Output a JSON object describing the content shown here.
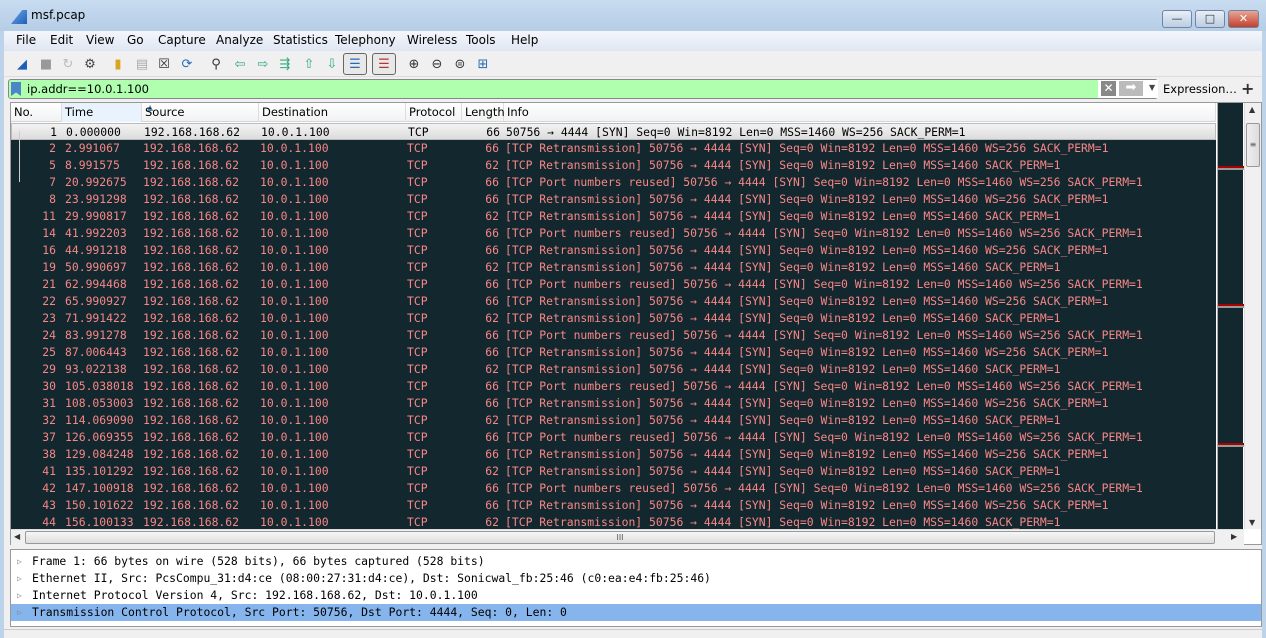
{
  "window": {
    "title": "msf.pcap"
  },
  "menu": [
    "File",
    "Edit",
    "View",
    "Go",
    "Capture",
    "Analyze",
    "Statistics",
    "Telephony",
    "Wireless",
    "Tools",
    "Help"
  ],
  "filter": {
    "value": "ip.addr==10.0.1.100",
    "expression_label": "Expression…",
    "add_label": "+"
  },
  "columns": [
    "No.",
    "Time",
    "Source",
    "Destination",
    "Protocol",
    "Length",
    "Info"
  ],
  "colors": {
    "row_bg": "#12272e",
    "row_fg": "#f78787",
    "selected_detail": "#86b5ee"
  },
  "packets": [
    {
      "no": "1",
      "time": "0.000000",
      "src": "192.168.168.62",
      "dst": "10.0.1.100",
      "proto": "TCP",
      "len": "66",
      "info": "50756 → 4444 [SYN] Seq=0 Win=8192 Len=0 MSS=1460 WS=256 SACK_PERM=1"
    },
    {
      "no": "2",
      "time": "2.991067",
      "src": "192.168.168.62",
      "dst": "10.0.1.100",
      "proto": "TCP",
      "len": "66",
      "info": "[TCP Retransmission] 50756 → 4444 [SYN] Seq=0 Win=8192 Len=0 MSS=1460 WS=256 SACK_PERM=1"
    },
    {
      "no": "5",
      "time": "8.991575",
      "src": "192.168.168.62",
      "dst": "10.0.1.100",
      "proto": "TCP",
      "len": "62",
      "info": "[TCP Retransmission] 50756 → 4444 [SYN] Seq=0 Win=8192 Len=0 MSS=1460 SACK_PERM=1"
    },
    {
      "no": "7",
      "time": "20.992675",
      "src": "192.168.168.62",
      "dst": "10.0.1.100",
      "proto": "TCP",
      "len": "66",
      "info": "[TCP Port numbers reused] 50756 → 4444 [SYN] Seq=0 Win=8192 Len=0 MSS=1460 WS=256 SACK_PERM=1"
    },
    {
      "no": "8",
      "time": "23.991298",
      "src": "192.168.168.62",
      "dst": "10.0.1.100",
      "proto": "TCP",
      "len": "66",
      "info": "[TCP Retransmission] 50756 → 4444 [SYN] Seq=0 Win=8192 Len=0 MSS=1460 WS=256 SACK_PERM=1"
    },
    {
      "no": "11",
      "time": "29.990817",
      "src": "192.168.168.62",
      "dst": "10.0.1.100",
      "proto": "TCP",
      "len": "62",
      "info": "[TCP Retransmission] 50756 → 4444 [SYN] Seq=0 Win=8192 Len=0 MSS=1460 SACK_PERM=1"
    },
    {
      "no": "14",
      "time": "41.992203",
      "src": "192.168.168.62",
      "dst": "10.0.1.100",
      "proto": "TCP",
      "len": "66",
      "info": "[TCP Port numbers reused] 50756 → 4444 [SYN] Seq=0 Win=8192 Len=0 MSS=1460 WS=256 SACK_PERM=1"
    },
    {
      "no": "16",
      "time": "44.991218",
      "src": "192.168.168.62",
      "dst": "10.0.1.100",
      "proto": "TCP",
      "len": "66",
      "info": "[TCP Retransmission] 50756 → 4444 [SYN] Seq=0 Win=8192 Len=0 MSS=1460 WS=256 SACK_PERM=1"
    },
    {
      "no": "19",
      "time": "50.990697",
      "src": "192.168.168.62",
      "dst": "10.0.1.100",
      "proto": "TCP",
      "len": "62",
      "info": "[TCP Retransmission] 50756 → 4444 [SYN] Seq=0 Win=8192 Len=0 MSS=1460 SACK_PERM=1"
    },
    {
      "no": "21",
      "time": "62.994468",
      "src": "192.168.168.62",
      "dst": "10.0.1.100",
      "proto": "TCP",
      "len": "66",
      "info": "[TCP Port numbers reused] 50756 → 4444 [SYN] Seq=0 Win=8192 Len=0 MSS=1460 WS=256 SACK_PERM=1"
    },
    {
      "no": "22",
      "time": "65.990927",
      "src": "192.168.168.62",
      "dst": "10.0.1.100",
      "proto": "TCP",
      "len": "66",
      "info": "[TCP Retransmission] 50756 → 4444 [SYN] Seq=0 Win=8192 Len=0 MSS=1460 WS=256 SACK_PERM=1"
    },
    {
      "no": "23",
      "time": "71.991422",
      "src": "192.168.168.62",
      "dst": "10.0.1.100",
      "proto": "TCP",
      "len": "62",
      "info": "[TCP Retransmission] 50756 → 4444 [SYN] Seq=0 Win=8192 Len=0 MSS=1460 SACK_PERM=1"
    },
    {
      "no": "24",
      "time": "83.991278",
      "src": "192.168.168.62",
      "dst": "10.0.1.100",
      "proto": "TCP",
      "len": "66",
      "info": "[TCP Port numbers reused] 50756 → 4444 [SYN] Seq=0 Win=8192 Len=0 MSS=1460 WS=256 SACK_PERM=1"
    },
    {
      "no": "25",
      "time": "87.006443",
      "src": "192.168.168.62",
      "dst": "10.0.1.100",
      "proto": "TCP",
      "len": "66",
      "info": "[TCP Retransmission] 50756 → 4444 [SYN] Seq=0 Win=8192 Len=0 MSS=1460 WS=256 SACK_PERM=1"
    },
    {
      "no": "29",
      "time": "93.022138",
      "src": "192.168.168.62",
      "dst": "10.0.1.100",
      "proto": "TCP",
      "len": "62",
      "info": "[TCP Retransmission] 50756 → 4444 [SYN] Seq=0 Win=8192 Len=0 MSS=1460 SACK_PERM=1"
    },
    {
      "no": "30",
      "time": "105.038018",
      "src": "192.168.168.62",
      "dst": "10.0.1.100",
      "proto": "TCP",
      "len": "66",
      "info": "[TCP Port numbers reused] 50756 → 4444 [SYN] Seq=0 Win=8192 Len=0 MSS=1460 WS=256 SACK_PERM=1"
    },
    {
      "no": "31",
      "time": "108.053003",
      "src": "192.168.168.62",
      "dst": "10.0.1.100",
      "proto": "TCP",
      "len": "66",
      "info": "[TCP Retransmission] 50756 → 4444 [SYN] Seq=0 Win=8192 Len=0 MSS=1460 WS=256 SACK_PERM=1"
    },
    {
      "no": "32",
      "time": "114.069090",
      "src": "192.168.168.62",
      "dst": "10.0.1.100",
      "proto": "TCP",
      "len": "62",
      "info": "[TCP Retransmission] 50756 → 4444 [SYN] Seq=0 Win=8192 Len=0 MSS=1460 SACK_PERM=1"
    },
    {
      "no": "37",
      "time": "126.069355",
      "src": "192.168.168.62",
      "dst": "10.0.1.100",
      "proto": "TCP",
      "len": "66",
      "info": "[TCP Port numbers reused] 50756 → 4444 [SYN] Seq=0 Win=8192 Len=0 MSS=1460 WS=256 SACK_PERM=1"
    },
    {
      "no": "38",
      "time": "129.084248",
      "src": "192.168.168.62",
      "dst": "10.0.1.100",
      "proto": "TCP",
      "len": "66",
      "info": "[TCP Retransmission] 50756 → 4444 [SYN] Seq=0 Win=8192 Len=0 MSS=1460 WS=256 SACK_PERM=1"
    },
    {
      "no": "41",
      "time": "135.101292",
      "src": "192.168.168.62",
      "dst": "10.0.1.100",
      "proto": "TCP",
      "len": "62",
      "info": "[TCP Retransmission] 50756 → 4444 [SYN] Seq=0 Win=8192 Len=0 MSS=1460 SACK_PERM=1"
    },
    {
      "no": "42",
      "time": "147.100918",
      "src": "192.168.168.62",
      "dst": "10.0.1.100",
      "proto": "TCP",
      "len": "66",
      "info": "[TCP Port numbers reused] 50756 → 4444 [SYN] Seq=0 Win=8192 Len=0 MSS=1460 WS=256 SACK_PERM=1"
    },
    {
      "no": "43",
      "time": "150.101622",
      "src": "192.168.168.62",
      "dst": "10.0.1.100",
      "proto": "TCP",
      "len": "66",
      "info": "[TCP Retransmission] 50756 → 4444 [SYN] Seq=0 Win=8192 Len=0 MSS=1460 WS=256 SACK_PERM=1"
    },
    {
      "no": "44",
      "time": "156.100133",
      "src": "192.168.168.62",
      "dst": "10.0.1.100",
      "proto": "TCP",
      "len": "62",
      "info": "[TCP Retransmission] 50756 → 4444 [SYN] Seq=0 Win=8192 Len=0 MSS=1460 SACK_PERM=1"
    }
  ],
  "details": [
    "Frame 1: 66 bytes on wire (528 bits), 66 bytes captured (528 bits)",
    "Ethernet II, Src: PcsCompu_31:d4:ce (08:00:27:31:d4:ce), Dst: Sonicwal_fb:25:46 (c0:ea:e4:fb:25:46)",
    "Internet Protocol Version 4, Src: 192.168.168.62, Dst: 10.0.1.100",
    "Transmission Control Protocol, Src Port: 50756, Dst Port: 4444, Seq: 0, Len: 0"
  ],
  "hscroll_grip": "III",
  "window_buttons": {
    "minimize": "—",
    "maximize": "□",
    "close": "✕"
  }
}
